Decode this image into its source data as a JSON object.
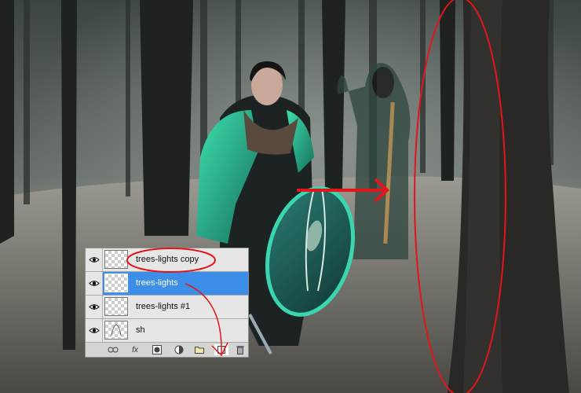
{
  "layers_panel": {
    "layers": [
      {
        "name": "trees-lights copy",
        "selected": false,
        "visible": true
      },
      {
        "name": "trees-lights",
        "selected": true,
        "visible": true
      },
      {
        "name": "trees-lights #1",
        "selected": false,
        "visible": true
      },
      {
        "name": "sh",
        "selected": false,
        "visible": true
      }
    ],
    "bottom_buttons": {
      "fx_label": "fx"
    }
  },
  "icons": [
    "eye-icon",
    "link-layers-icon",
    "fx-icon",
    "layer-mask-icon",
    "adjustment-layer-icon",
    "new-group-icon",
    "new-layer-icon",
    "delete-layer-icon"
  ],
  "colors": {
    "selection": "#3d8ee8",
    "annotation_red": "#e0161a",
    "cloak_teal": "#2fb793"
  }
}
